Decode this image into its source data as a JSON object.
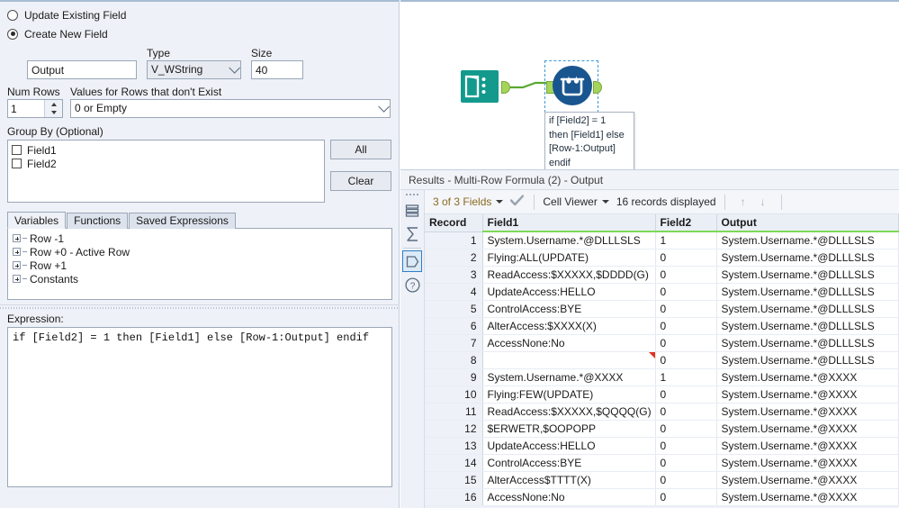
{
  "config": {
    "radio_update": "Update Existing Field",
    "radio_create": "Create New  Field",
    "output_field_label": "",
    "output_field_value": "Output",
    "type_label": "Type",
    "type_value": "V_WString",
    "size_label": "Size",
    "size_value": "40",
    "num_rows_label": "Num Rows",
    "num_rows_value": "1",
    "values_label": "Values for Rows that don't Exist",
    "values_value": "0 or Empty",
    "group_by_label": "Group By (Optional)",
    "group_fields": [
      "Field1",
      "Field2"
    ],
    "btn_all": "All",
    "btn_clear": "Clear",
    "tabs": [
      "Variables",
      "Functions",
      "Saved Expressions"
    ],
    "active_tab": "Variables",
    "tree_items": [
      "Row -1",
      "Row +0 - Active Row",
      "Row +1",
      "Constants"
    ],
    "expression_label": "Expression:",
    "expression_value": "if [Field2] = 1 then [Field1] else [Row-1:Output] endif"
  },
  "canvas": {
    "input_node_name": "text-input-tool",
    "formula_node_name": "multi-row-formula-tool",
    "annotation": "if [Field2] = 1\nthen [Field1] else\n[Row-1:Output]\nendif",
    "colors": {
      "input_teal": "#139a8c",
      "formula_blue": "#19558f",
      "port_green": "#a5d45b",
      "connector_green": "#5aa832",
      "selection_blue": "#3d9ad6"
    }
  },
  "results": {
    "title_prefix": "Results",
    "title": "Results - Multi-Row Formula (2) - Output",
    "toolbar": {
      "fields_count": "3 of 3 Fields",
      "check_icon": "check-icon",
      "cell_viewer": "Cell Viewer",
      "records_displayed": "16 records displayed",
      "arrow_up": "↑",
      "arrow_down": "↓"
    },
    "rail_icons": [
      "records-list-icon",
      "sigma-sum-icon",
      "data-pentagon-icon",
      "help-icon"
    ],
    "columns": [
      "Record",
      "Field1",
      "Field2",
      "Output"
    ],
    "rows": [
      {
        "record": "1",
        "field1": "System.Username.*@DLLLSLS",
        "field2": "1",
        "output": "System.Username.*@DLLLSLS",
        "mark": false
      },
      {
        "record": "2",
        "field1": "Flying:ALL(UPDATE)",
        "field2": "0",
        "output": "System.Username.*@DLLLSLS",
        "mark": false
      },
      {
        "record": "3",
        "field1": "ReadAccess:$XXXXX,$DDDD(G)",
        "field2": "0",
        "output": "System.Username.*@DLLLSLS",
        "mark": false
      },
      {
        "record": "4",
        "field1": "UpdateAccess:HELLO",
        "field2": "0",
        "output": "System.Username.*@DLLLSLS",
        "mark": false
      },
      {
        "record": "5",
        "field1": "ControlAccess:BYE",
        "field2": "0",
        "output": "System.Username.*@DLLLSLS",
        "mark": false
      },
      {
        "record": "6",
        "field1": "AlterAccess:$XXXX(X)",
        "field2": "0",
        "output": "System.Username.*@DLLLSLS",
        "mark": false
      },
      {
        "record": "7",
        "field1": "AccessNone:No",
        "field2": "0",
        "output": "System.Username.*@DLLLSLS",
        "mark": false
      },
      {
        "record": "8",
        "field1": "",
        "field2": "0",
        "output": "System.Username.*@DLLLSLS",
        "mark": true
      },
      {
        "record": "9",
        "field1": "System.Username.*@XXXX",
        "field2": "1",
        "output": "System.Username.*@XXXX",
        "mark": false
      },
      {
        "record": "10",
        "field1": "Flying:FEW(UPDATE)",
        "field2": "0",
        "output": "System.Username.*@XXXX",
        "mark": false
      },
      {
        "record": "11",
        "field1": "ReadAccess:$XXXXX,$QQQQ(G)",
        "field2": "0",
        "output": "System.Username.*@XXXX",
        "mark": false
      },
      {
        "record": "12",
        "field1": "$ERWETR,$OOPOPP",
        "field2": "0",
        "output": "System.Username.*@XXXX",
        "mark": false
      },
      {
        "record": "13",
        "field1": "UpdateAccess:HELLO",
        "field2": "0",
        "output": "System.Username.*@XXXX",
        "mark": false
      },
      {
        "record": "14",
        "field1": "ControlAccess:BYE",
        "field2": "0",
        "output": "System.Username.*@XXXX",
        "mark": false
      },
      {
        "record": "15",
        "field1": "AlterAccess$TTTT(X)",
        "field2": "0",
        "output": "System.Username.*@XXXX",
        "mark": false
      },
      {
        "record": "16",
        "field1": "AccessNone:No",
        "field2": "0",
        "output": "System.Username.*@XXXX",
        "mark": false
      }
    ]
  }
}
